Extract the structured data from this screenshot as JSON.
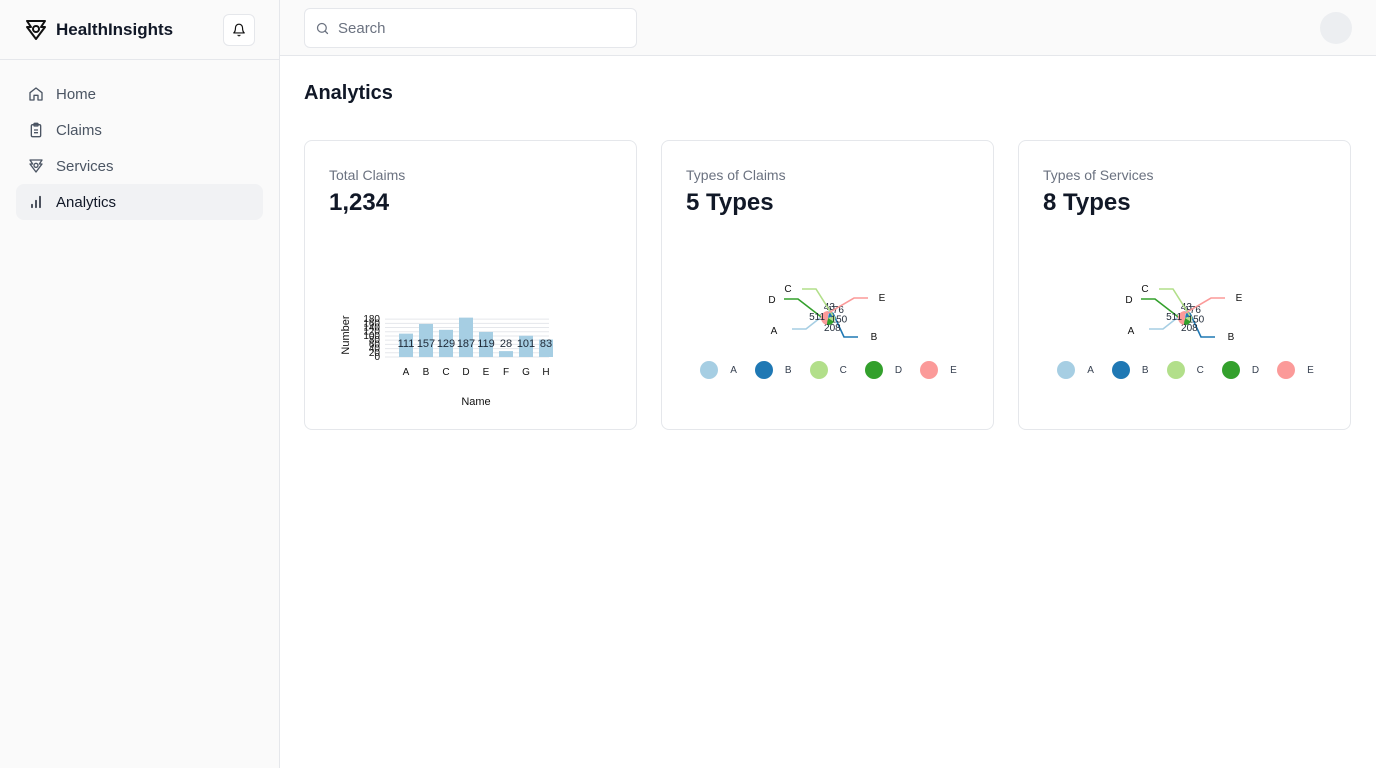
{
  "app": {
    "name": "HealthInsights"
  },
  "search": {
    "placeholder": "Search"
  },
  "sidebar": {
    "items": [
      {
        "label": "Home",
        "icon": "home-icon"
      },
      {
        "label": "Claims",
        "icon": "clipboard-icon"
      },
      {
        "label": "Services",
        "icon": "services-icon"
      },
      {
        "label": "Analytics",
        "icon": "bar-chart-icon",
        "active": true
      }
    ]
  },
  "page": {
    "title": "Analytics"
  },
  "cards": [
    {
      "label": "Total Claims",
      "value": "1,234"
    },
    {
      "label": "Types of Claims",
      "value": "5 Types"
    },
    {
      "label": "Types of Services",
      "value": "8 Types"
    }
  ],
  "chart_data": [
    {
      "type": "bar",
      "categories": [
        "A",
        "B",
        "C",
        "D",
        "E",
        "F",
        "G",
        "H"
      ],
      "values": [
        111,
        157,
        129,
        187,
        119,
        28,
        101,
        83
      ],
      "xlabel": "Name",
      "ylabel": "Number",
      "yticks": [
        0,
        20,
        40,
        60,
        80,
        100,
        120,
        140,
        160,
        180
      ],
      "ylim": [
        0,
        190
      ],
      "color": "#a6cee3"
    },
    {
      "type": "pie",
      "categories": [
        "A",
        "B",
        "C",
        "D",
        "E"
      ],
      "values": [
        43,
        176,
        150,
        208,
        511
      ],
      "colors": [
        "#a6cee3",
        "#1f78b4",
        "#b2df8a",
        "#33a02c",
        "#fb9a99"
      ]
    },
    {
      "type": "pie",
      "categories": [
        "A",
        "B",
        "C",
        "D",
        "E"
      ],
      "values": [
        43,
        176,
        150,
        208,
        511
      ],
      "colors": [
        "#a6cee3",
        "#1f78b4",
        "#b2df8a",
        "#33a02c",
        "#fb9a99"
      ]
    }
  ]
}
